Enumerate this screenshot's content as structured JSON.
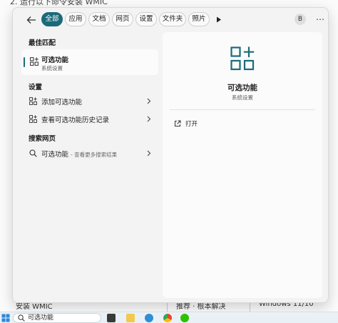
{
  "background": {
    "heading": "2. 运行以下命令安装 WMIC",
    "bottom_cells": [
      "安装 WMIC",
      "推荐 · 根本解决",
      "Windows 11/10"
    ]
  },
  "tabs": [
    {
      "label": "全部",
      "active": true
    },
    {
      "label": "应用",
      "active": false
    },
    {
      "label": "文档",
      "active": false
    },
    {
      "label": "网页",
      "active": false
    },
    {
      "label": "设置",
      "active": false
    },
    {
      "label": "文件夹",
      "active": false
    },
    {
      "label": "照片",
      "active": false
    }
  ],
  "header": {
    "avatar_initial": "B",
    "menu_glyph": "⋯"
  },
  "best_match": {
    "section_title": "最佳匹配",
    "name": "可选功能",
    "subtitle": "系统设置"
  },
  "settings": {
    "section_title": "设置",
    "items": [
      {
        "label": "添加可选功能"
      },
      {
        "label": "查看可选功能历史记录"
      }
    ]
  },
  "web_search": {
    "section_title": "搜索网页",
    "query": "可选功能",
    "hint": "- 查看更多搜索结果"
  },
  "preview": {
    "title": "可选功能",
    "subtitle": "系统设置",
    "actions": [
      {
        "label": "打开",
        "icon": "open-external-icon"
      }
    ]
  },
  "taskbar": {
    "search_value": "可选功能",
    "apps": [
      "file-icon",
      "folder-icon",
      "refresh-icon",
      "chrome-icon",
      "wechat-icon"
    ]
  },
  "colors": {
    "accent": "#1a6b7a"
  }
}
